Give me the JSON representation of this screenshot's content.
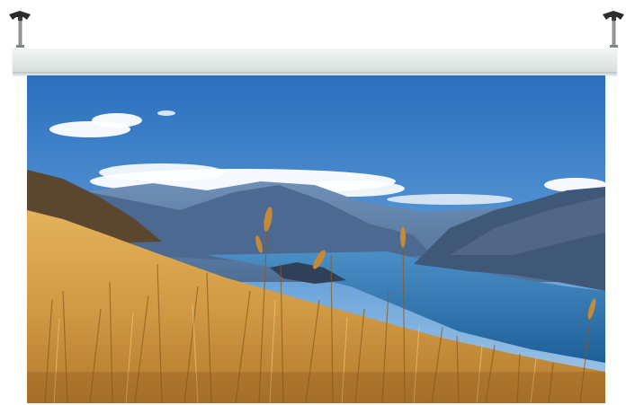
{
  "scene": {
    "subject": "motorized-projection-screen",
    "mounts": [
      "ceiling-bracket-icon",
      "ceiling-bracket-icon"
    ],
    "projected_image": "landscape-lake-mountains-golden-grass",
    "colors": {
      "sky_top": "#2a74c2",
      "sky_bottom": "#9cc4e6",
      "lake": "#2f78b3",
      "mountain_far": "#5b7fa8",
      "mountain_near": "#4a5f7a",
      "grass": "#d9a24a",
      "grass_shadow": "#a86f28",
      "housing": "#e3e9e6"
    }
  }
}
